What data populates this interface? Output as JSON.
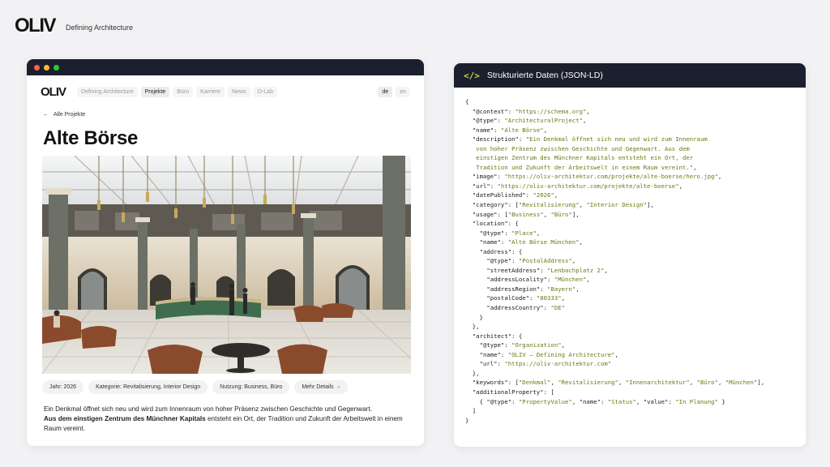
{
  "brand": {
    "logo": "OLIV",
    "tagline": "Defining Architecture"
  },
  "site": {
    "logo": "OLIV",
    "nav": [
      "Defining Architecture",
      "Projekte",
      "Büro",
      "Karriere",
      "News",
      "O-Lab"
    ],
    "nav_active": "Projekte",
    "languages": [
      "de",
      "en"
    ],
    "lang_active": "de",
    "back_link": "Alle Projekte",
    "title": "Alte Börse",
    "meta": {
      "year": "Jahr: 2026",
      "category": "Kategorie: Revitalisierung, Interior Design",
      "usage": "Nutzung: Business, Büro",
      "more": "Mehr Details"
    },
    "description": {
      "line1": "Ein Denkmal öffnet sich neu und wird zum Innenraum von hoher Präsenz zwischen Geschichte und Gegenwart.",
      "bold": "Aus dem einstigen Zentrum des Münchner Kapitals",
      "rest": " entsteht ein Ort, der Tradition und Zukunft der Arbeitswelt in einem Raum vereint."
    }
  },
  "code_panel": {
    "icon": "code-icon",
    "title": "Strukturierte Daten (JSON-LD)",
    "lines": [
      [
        [
          "k",
          "{"
        ]
      ],
      [
        [
          "k",
          "  \"@context\": "
        ],
        [
          "s",
          "\"https://schema.org\""
        ],
        [
          "k",
          ","
        ]
      ],
      [
        [
          "k",
          "  \"@type\": "
        ],
        [
          "s",
          "\"ArchitecturalProject\""
        ],
        [
          "k",
          ","
        ]
      ],
      [
        [
          "k",
          "  \"name\": "
        ],
        [
          "s",
          "\"Alte Börse\""
        ],
        [
          "k",
          ","
        ]
      ],
      [
        [
          "k",
          "  \"description\": "
        ],
        [
          "s",
          "\"Ein Denkmal öffnet sich neu und wird zum Innenraum"
        ]
      ],
      [
        [
          "s",
          "   von hoher Präsenz zwischen Geschichte und Gegenwart. Aus dem"
        ]
      ],
      [
        [
          "s",
          "   einstigen Zentrum des Münchner Kapitals entsteht ein Ort, der"
        ]
      ],
      [
        [
          "s",
          "   Tradition und Zukunft der Arbeitswelt in einem Raum vereint.\""
        ],
        [
          "k",
          ","
        ]
      ],
      [
        [
          "k",
          "  \"image\": "
        ],
        [
          "s",
          "\"https://oliv-architektur.com/projekte/alte-boerse/hero.jpg\""
        ],
        [
          "k",
          ","
        ]
      ],
      [
        [
          "k",
          "  \"url\": "
        ],
        [
          "s",
          "\"https://oliv-architektur.com/projekte/alte-boerse\""
        ],
        [
          "k",
          ","
        ]
      ],
      [
        [
          "k",
          "  \"datePublished\": "
        ],
        [
          "s",
          "\"2026\""
        ],
        [
          "k",
          ","
        ]
      ],
      [
        [
          "k",
          "  \"category\": ["
        ],
        [
          "s",
          "\"Revitalisierung\""
        ],
        [
          "k",
          ", "
        ],
        [
          "s",
          "\"Interior Design\""
        ],
        [
          "k",
          "],"
        ]
      ],
      [
        [
          "k",
          "  \"usage\": ["
        ],
        [
          "s",
          "\"Business\""
        ],
        [
          "k",
          ", "
        ],
        [
          "s",
          "\"Büro\""
        ],
        [
          "k",
          "],"
        ]
      ],
      [
        [
          "k",
          "  \"location\": {"
        ]
      ],
      [
        [
          "k",
          "    \"@type\": "
        ],
        [
          "s",
          "\"Place\""
        ],
        [
          "k",
          ","
        ]
      ],
      [
        [
          "k",
          "    \"name\": "
        ],
        [
          "s",
          "\"Alte Börse München\""
        ],
        [
          "k",
          ","
        ]
      ],
      [
        [
          "k",
          "    \"address\": {"
        ]
      ],
      [
        [
          "k",
          "      \"@type\": "
        ],
        [
          "s",
          "\"PostalAddress\""
        ],
        [
          "k",
          ","
        ]
      ],
      [
        [
          "k",
          "      \"streetAddress\": "
        ],
        [
          "s",
          "\"Lenbachplatz 2\""
        ],
        [
          "k",
          ","
        ]
      ],
      [
        [
          "k",
          "      \"addressLocality\": "
        ],
        [
          "s",
          "\"München\""
        ],
        [
          "k",
          ","
        ]
      ],
      [
        [
          "k",
          "      \"addressRegion\": "
        ],
        [
          "s",
          "\"Bayern\""
        ],
        [
          "k",
          ","
        ]
      ],
      [
        [
          "k",
          "      \"postalCode\": "
        ],
        [
          "s",
          "\"80333\""
        ],
        [
          "k",
          ","
        ]
      ],
      [
        [
          "k",
          "      \"addressCountry\": "
        ],
        [
          "s",
          "\"DE\""
        ]
      ],
      [
        [
          "k",
          "    }"
        ]
      ],
      [
        [
          "k",
          "  },"
        ]
      ],
      [
        [
          "k",
          "  \"architect\": {"
        ]
      ],
      [
        [
          "k",
          "    \"@type\": "
        ],
        [
          "s",
          "\"Organization\""
        ],
        [
          "k",
          ","
        ]
      ],
      [
        [
          "k",
          "    \"name\": "
        ],
        [
          "s",
          "\"OLIV – Defining Architecture\""
        ],
        [
          "k",
          ","
        ]
      ],
      [
        [
          "k",
          "    \"url\": "
        ],
        [
          "s",
          "\"https://oliv-architektur.com\""
        ]
      ],
      [
        [
          "k",
          "  },"
        ]
      ],
      [
        [
          "k",
          "  \"keywords\": ["
        ],
        [
          "s",
          "\"Denkmal\""
        ],
        [
          "k",
          ", "
        ],
        [
          "s",
          "\"Revitalisierung\""
        ],
        [
          "k",
          ", "
        ],
        [
          "s",
          "\"Innenarchitektur\""
        ],
        [
          "k",
          ", "
        ],
        [
          "s",
          "\"Büro\""
        ],
        [
          "k",
          ", "
        ],
        [
          "s",
          "\"München\""
        ],
        [
          "k",
          "],"
        ]
      ],
      [
        [
          "k",
          "  \"additionalProperty\": ["
        ]
      ],
      [
        [
          "k",
          "    { \"@type\": "
        ],
        [
          "s",
          "\"PropertyValue\""
        ],
        [
          "k",
          ", \"name\": "
        ],
        [
          "s",
          "\"Status\""
        ],
        [
          "k",
          ", \"value\": "
        ],
        [
          "s",
          "\"In Planung\""
        ],
        [
          "k",
          " }"
        ]
      ],
      [
        [
          "k",
          "  ]"
        ]
      ],
      [
        [
          "k",
          "}"
        ]
      ]
    ]
  }
}
